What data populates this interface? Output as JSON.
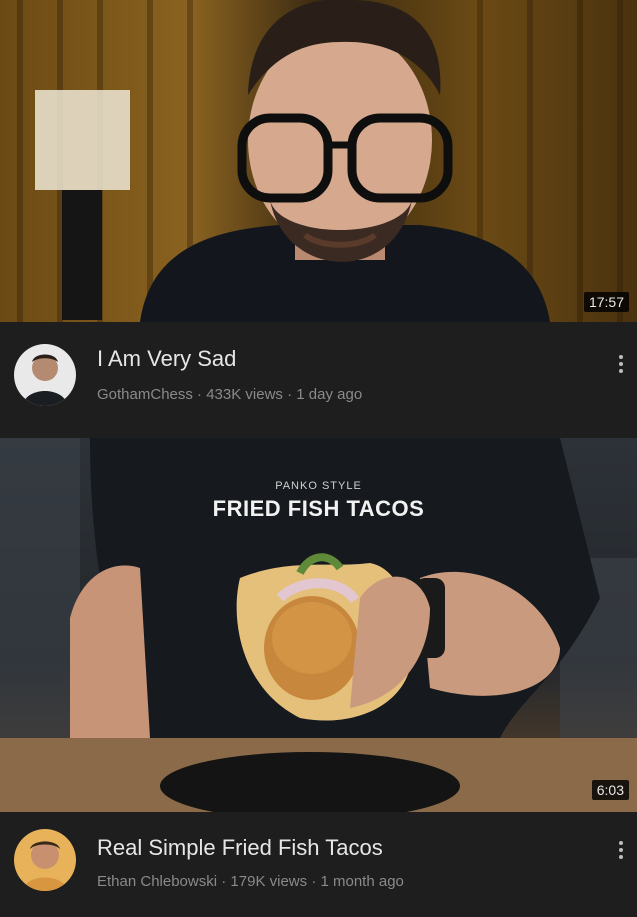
{
  "videos": [
    {
      "duration": "17:57",
      "title": "I Am Very Sad",
      "channel": "GothamChess",
      "views": "433K views",
      "age": "1 day ago",
      "separator": "·"
    },
    {
      "duration": "6:03",
      "title": "Real Simple Fried Fish Tacos",
      "channel": "Ethan Chlebowski",
      "views": "179K views",
      "age": "1 month ago",
      "separator": "·",
      "overlay_small": "PANKO STYLE",
      "overlay_big": "FRIED FISH TACOS"
    }
  ],
  "colors": {
    "background": "#1e1e1e",
    "title": "#e6e6e6",
    "meta": "#8a8a8a"
  }
}
